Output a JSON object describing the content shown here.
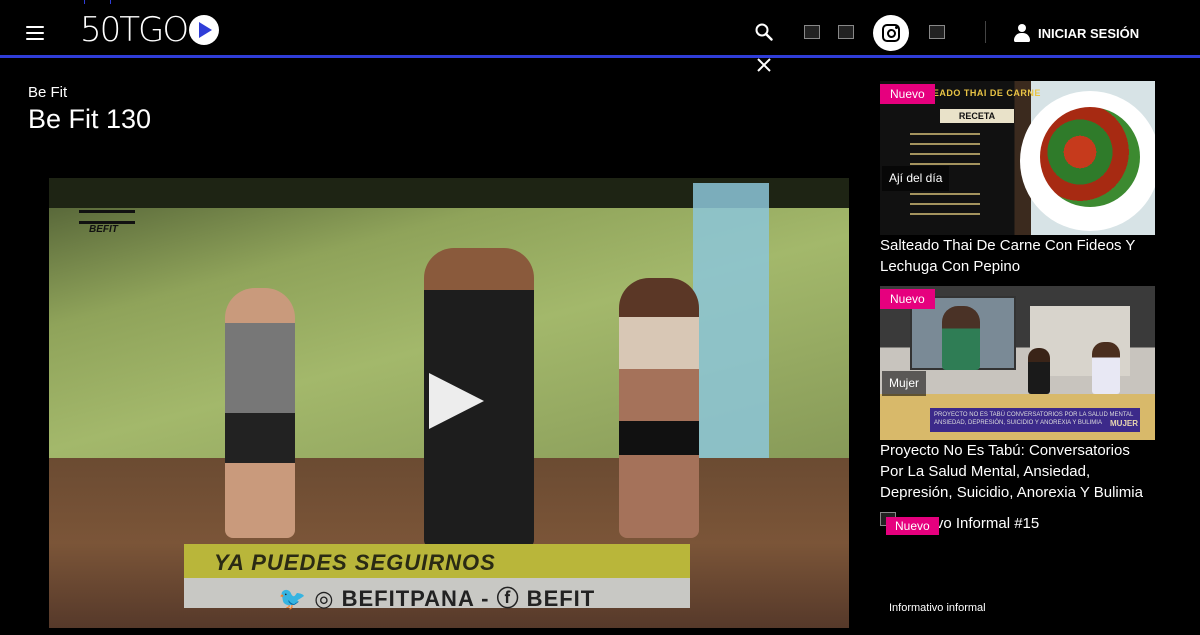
{
  "header": {
    "logo": "50TGO",
    "login_label": "INICIAR SESIÓN",
    "icons": [
      "menu-icon",
      "search-icon",
      "social-image",
      "social-image",
      "instagram-icon",
      "social-image",
      "user-icon",
      "close-icon"
    ],
    "accent_color": "#2f3dd8"
  },
  "page": {
    "show_name": "Be Fit",
    "episode_title": "Be Fit 130"
  },
  "video": {
    "overlay_logo": "BEFIT",
    "banner_line1": "YA PUEDES SEGUIRNOS",
    "banner_line2": "🐦 ◎ BEFITPANA - ⓕ BEFIT",
    "stripe_text": "BEFIT"
  },
  "sidebar": {
    "badge_color": "#e6007e",
    "cards": [
      {
        "badge": "Nuevo",
        "category": "Ají del día",
        "title": "Salteado Thai De Carne Con Fideos Y Lechuga Con Pepino",
        "thumb_title": "SALTEADO THAI DE CARNE",
        "thumb_label": "RECETA"
      },
      {
        "badge": "Nuevo",
        "category": "Mujer",
        "title": "Proyecto No Es Tabú: Conversatorios Por La Salud Mental, Ansiedad, Depresión, Suicidio, Anorexia Y Bulimia",
        "thumb_lower_third": "PROYECTO NO ES TABÚ CONVERSATORIOS POR LA SALUD MENTAL ANSIEDAD, DEPRESIÓN, SUICIDIO Y ANOREXIA Y BULIMIA",
        "thumb_brand": "MUJER"
      },
      {
        "badge": "Nuevo",
        "title": "Informativo Informal #15",
        "title_visible": "ativo Informal #15",
        "category": "Informativo informal"
      }
    ]
  }
}
